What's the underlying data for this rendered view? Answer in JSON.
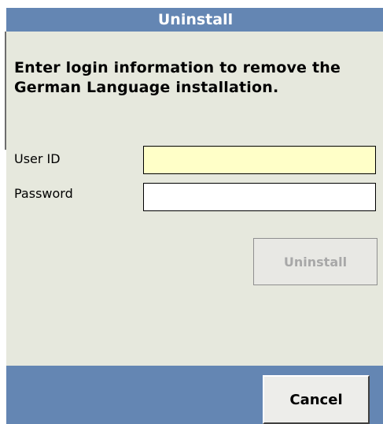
{
  "window": {
    "title": "Uninstall"
  },
  "form": {
    "instructions": "Enter login information to remove the German Language installation.",
    "user_id": {
      "label": "User ID",
      "value": "",
      "bg_color": "#ffffc8"
    },
    "password": {
      "label": "Password",
      "value": ""
    },
    "uninstall_button": {
      "label": "Uninstall",
      "enabled": false
    }
  },
  "footer": {
    "cancel_button": {
      "label": "Cancel"
    }
  },
  "colors": {
    "title_bar": "#6486b3",
    "content_bg": "#e6e8dd",
    "disabled_text": "#a8a8a8"
  }
}
